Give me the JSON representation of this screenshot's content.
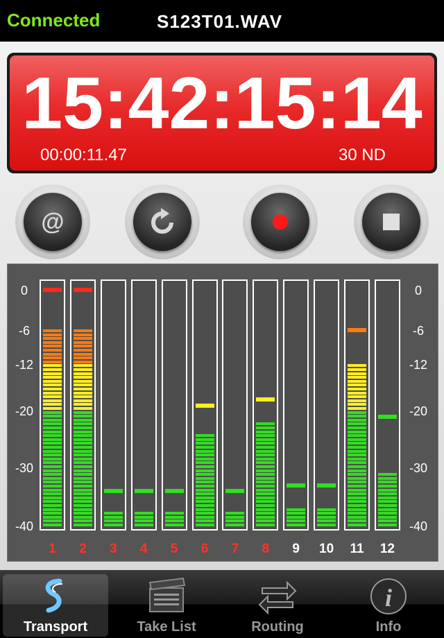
{
  "header": {
    "status": "Connected",
    "filename": "S123T01.WAV"
  },
  "timecode": {
    "main": "15:42:15:14",
    "elapsed": "00:00:11.47",
    "frame_rate": "30 ND"
  },
  "transport": {
    "buttons": [
      {
        "name": "locate-button",
        "icon": "at-icon"
      },
      {
        "name": "loop-button",
        "icon": "refresh-icon"
      },
      {
        "name": "record-button",
        "icon": "record-icon"
      },
      {
        "name": "stop-button",
        "icon": "stop-icon"
      }
    ]
  },
  "meters": {
    "scale": [
      "0",
      "-6",
      "-12",
      "-20",
      "-30",
      "-40"
    ],
    "channels": [
      {
        "label": "1",
        "armed": true,
        "level": -6,
        "peak": 0
      },
      {
        "label": "2",
        "armed": true,
        "level": -6,
        "peak": 0
      },
      {
        "label": "3",
        "armed": true,
        "level": -38,
        "peak": -34
      },
      {
        "label": "4",
        "armed": true,
        "level": -38,
        "peak": -34
      },
      {
        "label": "5",
        "armed": true,
        "level": -38,
        "peak": -34
      },
      {
        "label": "6",
        "armed": true,
        "level": -24,
        "peak": -19
      },
      {
        "label": "7",
        "armed": true,
        "level": -38,
        "peak": -34
      },
      {
        "label": "8",
        "armed": true,
        "level": -22,
        "peak": -18
      },
      {
        "label": "9",
        "armed": false,
        "level": -37,
        "peak": -33
      },
      {
        "label": "10",
        "armed": false,
        "level": -37,
        "peak": -33
      },
      {
        "label": "11",
        "armed": false,
        "level": -12,
        "peak": -6
      },
      {
        "label": "12",
        "armed": false,
        "level": -31,
        "peak": -21
      }
    ],
    "colors": {
      "green": "#33dd22",
      "yellow": "#ffee22",
      "orange": "#ff7a10",
      "red": "#ff2a1a",
      "armed_label": "#ff3322",
      "idle_label": "#ffffff"
    }
  },
  "tabbar": {
    "tabs": [
      {
        "label": "Transport",
        "icon": "transport-logo-icon",
        "active": true
      },
      {
        "label": "Take List",
        "icon": "clapperboard-icon",
        "active": false
      },
      {
        "label": "Routing",
        "icon": "routing-arrows-icon",
        "active": false
      },
      {
        "label": "Info",
        "icon": "info-icon",
        "active": false
      }
    ]
  }
}
